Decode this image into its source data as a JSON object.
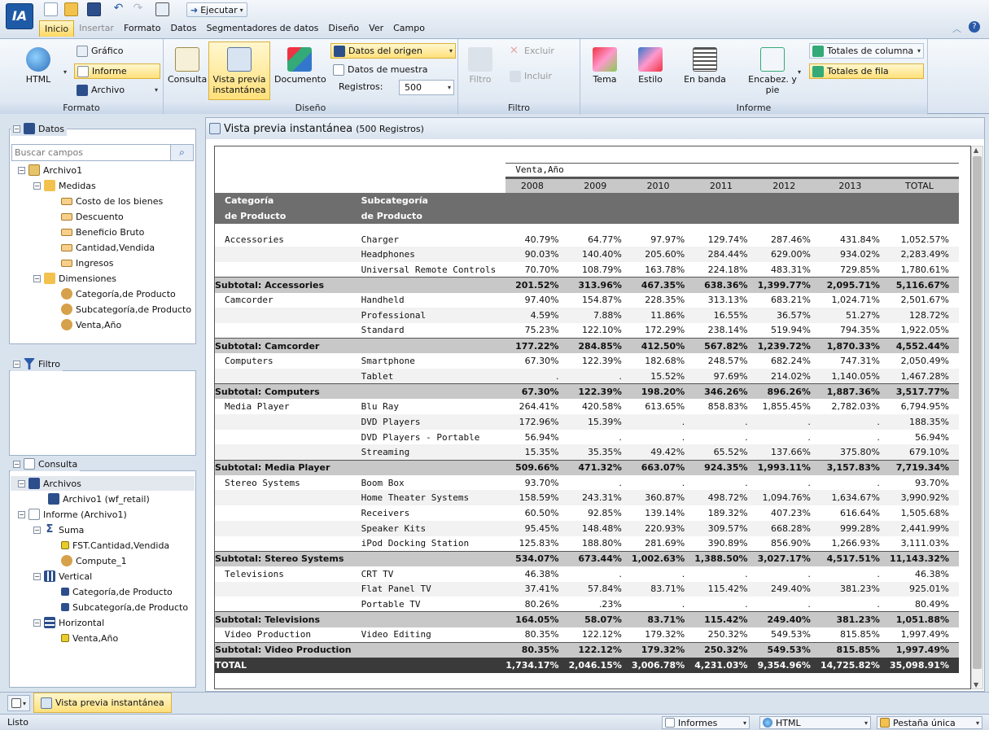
{
  "app": {
    "logo": "IA",
    "run_label": "Ejecutar"
  },
  "menu": {
    "tabs": [
      {
        "label": "Inicio",
        "active": true
      },
      {
        "label": "Insertar",
        "disabled": true
      },
      {
        "label": "Formato"
      },
      {
        "label": "Datos"
      },
      {
        "label": "Segmentadores de datos"
      },
      {
        "label": "Diseño"
      },
      {
        "label": "Ver"
      },
      {
        "label": "Campo"
      }
    ]
  },
  "ribbon": {
    "formato": {
      "label": "Formato",
      "html": "HTML",
      "grafico": "Gráfico",
      "informe": "Informe",
      "archivo": "Archivo"
    },
    "diseno": {
      "label": "Diseño",
      "consulta": "Consulta",
      "vista_previa_1": "Vista previa",
      "vista_previa_2": "instantánea",
      "documento": "Documento",
      "datos_origen": "Datos del origen",
      "datos_muestra": "Datos de muestra",
      "registros_label": "Registros:",
      "registros_value": "500"
    },
    "filtro": {
      "label": "Filtro",
      "filtro": "Filtro",
      "excluir": "Excluir",
      "incluir": "Incluir"
    },
    "informe": {
      "label": "Informe",
      "tema": "Tema",
      "estilo": "Estilo",
      "en_banda": "En banda",
      "encabez_1": "Encabez. y",
      "encabez_2": "pie",
      "totales_columna": "Totales de columna",
      "totales_fila": "Totales de fila"
    }
  },
  "left": {
    "datos_title": "Datos",
    "search_placeholder": "Buscar campos",
    "tree": {
      "archivo": "Archivo1",
      "medidas": "Medidas",
      "measures": [
        "Costo de los bienes",
        "Descuento",
        "Beneficio Bruto",
        "Cantidad,Vendida",
        "Ingresos"
      ],
      "dimensiones": "Dimensiones",
      "dimensions": [
        "Categoría,de Producto",
        "Subcategoría,de Producto",
        "Venta,Año"
      ]
    },
    "filtro_title": "Filtro",
    "consulta_title": "Consulta",
    "query": {
      "archivos": "Archivos",
      "archivo1": "Archivo1 (wf_retail)",
      "informe": "Informe (Archivo1)",
      "suma": "Suma",
      "suma_items": [
        "FST.Cantidad,Vendida",
        "Compute_1"
      ],
      "vertical": "Vertical",
      "vertical_items": [
        "Categoría,de Producto",
        "Subcategoría,de Producto"
      ],
      "horizontal": "Horizontal",
      "horizontal_items": [
        "Venta,Año"
      ]
    }
  },
  "main": {
    "title": "Vista previa instantánea",
    "subtitle": "(500 Registros)",
    "report": {
      "across_title": "Venta,Año",
      "years": [
        "2008",
        "2009",
        "2010",
        "2011",
        "2012",
        "2013",
        "TOTAL"
      ],
      "col_headers": [
        [
          "Categoría",
          "de Producto"
        ],
        [
          "Subcategoría",
          "de Producto"
        ]
      ],
      "rows": [
        {
          "type": "row",
          "cat": "Accessories",
          "sub": "Charger",
          "v": [
            "40.79%",
            "64.77%",
            "97.97%",
            "129.74%",
            "287.46%",
            "431.84%",
            "1,052.57%"
          ]
        },
        {
          "type": "row",
          "cat": "",
          "sub": "Headphones",
          "v": [
            "90.03%",
            "140.40%",
            "205.60%",
            "284.44%",
            "629.00%",
            "934.02%",
            "2,283.49%"
          ]
        },
        {
          "type": "row",
          "cat": "",
          "sub": "Universal Remote Controls",
          "v": [
            "70.70%",
            "108.79%",
            "163.78%",
            "224.18%",
            "483.31%",
            "729.85%",
            "1,780.61%"
          ]
        },
        {
          "type": "sub",
          "cat": "Subtotal: Accessories",
          "sub": "",
          "v": [
            "201.52%",
            "313.96%",
            "467.35%",
            "638.36%",
            "1,399.77%",
            "2,095.71%",
            "5,116.67%"
          ]
        },
        {
          "type": "row",
          "cat": "Camcorder",
          "sub": "Handheld",
          "v": [
            "97.40%",
            "154.87%",
            "228.35%",
            "313.13%",
            "683.21%",
            "1,024.71%",
            "2,501.67%"
          ]
        },
        {
          "type": "row",
          "cat": "",
          "sub": "Professional",
          "v": [
            "4.59%",
            "7.88%",
            "11.86%",
            "16.55%",
            "36.57%",
            "51.27%",
            "128.72%"
          ]
        },
        {
          "type": "row",
          "cat": "",
          "sub": "Standard",
          "v": [
            "75.23%",
            "122.10%",
            "172.29%",
            "238.14%",
            "519.94%",
            "794.35%",
            "1,922.05%"
          ]
        },
        {
          "type": "sub",
          "cat": "Subtotal: Camcorder",
          "sub": "",
          "v": [
            "177.22%",
            "284.85%",
            "412.50%",
            "567.82%",
            "1,239.72%",
            "1,870.33%",
            "4,552.44%"
          ]
        },
        {
          "type": "row",
          "cat": "Computers",
          "sub": "Smartphone",
          "v": [
            "67.30%",
            "122.39%",
            "182.68%",
            "248.57%",
            "682.24%",
            "747.31%",
            "2,050.49%"
          ]
        },
        {
          "type": "row",
          "cat": "",
          "sub": "Tablet",
          "v": [
            ".",
            ".",
            "15.52%",
            "97.69%",
            "214.02%",
            "1,140.05%",
            "1,467.28%"
          ]
        },
        {
          "type": "sub",
          "cat": "Subtotal: Computers",
          "sub": "",
          "v": [
            "67.30%",
            "122.39%",
            "198.20%",
            "346.26%",
            "896.26%",
            "1,887.36%",
            "3,517.77%"
          ]
        },
        {
          "type": "row",
          "cat": "Media Player",
          "sub": "Blu Ray",
          "v": [
            "264.41%",
            "420.58%",
            "613.65%",
            "858.83%",
            "1,855.45%",
            "2,782.03%",
            "6,794.95%"
          ]
        },
        {
          "type": "row",
          "cat": "",
          "sub": "DVD Players",
          "v": [
            "172.96%",
            "15.39%",
            ".",
            ".",
            ".",
            ".",
            "188.35%"
          ]
        },
        {
          "type": "row",
          "cat": "",
          "sub": "DVD Players - Portable",
          "v": [
            "56.94%",
            ".",
            ".",
            ".",
            ".",
            ".",
            "56.94%"
          ]
        },
        {
          "type": "row",
          "cat": "",
          "sub": "Streaming",
          "v": [
            "15.35%",
            "35.35%",
            "49.42%",
            "65.52%",
            "137.66%",
            "375.80%",
            "679.10%"
          ]
        },
        {
          "type": "sub",
          "cat": "Subtotal: Media Player",
          "sub": "",
          "v": [
            "509.66%",
            "471.32%",
            "663.07%",
            "924.35%",
            "1,993.11%",
            "3,157.83%",
            "7,719.34%"
          ]
        },
        {
          "type": "row",
          "cat": "Stereo Systems",
          "sub": "Boom Box",
          "v": [
            "93.70%",
            ".",
            ".",
            ".",
            ".",
            ".",
            "93.70%"
          ]
        },
        {
          "type": "row",
          "cat": "",
          "sub": "Home Theater Systems",
          "v": [
            "158.59%",
            "243.31%",
            "360.87%",
            "498.72%",
            "1,094.76%",
            "1,634.67%",
            "3,990.92%"
          ]
        },
        {
          "type": "row",
          "cat": "",
          "sub": "Receivers",
          "v": [
            "60.50%",
            "92.85%",
            "139.14%",
            "189.32%",
            "407.23%",
            "616.64%",
            "1,505.68%"
          ]
        },
        {
          "type": "row",
          "cat": "",
          "sub": "Speaker Kits",
          "v": [
            "95.45%",
            "148.48%",
            "220.93%",
            "309.57%",
            "668.28%",
            "999.28%",
            "2,441.99%"
          ]
        },
        {
          "type": "row",
          "cat": "",
          "sub": "iPod Docking Station",
          "v": [
            "125.83%",
            "188.80%",
            "281.69%",
            "390.89%",
            "856.90%",
            "1,266.93%",
            "3,111.03%"
          ]
        },
        {
          "type": "sub",
          "cat": "Subtotal: Stereo Systems",
          "sub": "",
          "v": [
            "534.07%",
            "673.44%",
            "1,002.63%",
            "1,388.50%",
            "3,027.17%",
            "4,517.51%",
            "11,143.32%"
          ]
        },
        {
          "type": "row",
          "cat": "Televisions",
          "sub": "CRT TV",
          "v": [
            "46.38%",
            ".",
            ".",
            ".",
            ".",
            ".",
            "46.38%"
          ]
        },
        {
          "type": "row",
          "cat": "",
          "sub": "Flat Panel TV",
          "v": [
            "37.41%",
            "57.84%",
            "83.71%",
            "115.42%",
            "249.40%",
            "381.23%",
            "925.01%"
          ]
        },
        {
          "type": "row",
          "cat": "",
          "sub": "Portable TV",
          "v": [
            "80.26%",
            ".23%",
            ".",
            ".",
            ".",
            ".",
            "80.49%"
          ]
        },
        {
          "type": "sub",
          "cat": "Subtotal: Televisions",
          "sub": "",
          "v": [
            "164.05%",
            "58.07%",
            "83.71%",
            "115.42%",
            "249.40%",
            "381.23%",
            "1,051.88%"
          ]
        },
        {
          "type": "row",
          "cat": "Video Production",
          "sub": "Video Editing",
          "v": [
            "80.35%",
            "122.12%",
            "179.32%",
            "250.32%",
            "549.53%",
            "815.85%",
            "1,997.49%"
          ]
        },
        {
          "type": "sub",
          "cat": "Subtotal: Video Production",
          "sub": "",
          "v": [
            "80.35%",
            "122.12%",
            "179.32%",
            "250.32%",
            "549.53%",
            "815.85%",
            "1,997.49%"
          ]
        },
        {
          "type": "tot",
          "cat": "TOTAL",
          "sub": "",
          "v": [
            "1,734.17%",
            "2,046.15%",
            "3,006.78%",
            "4,231.03%",
            "9,354.96%",
            "14,725.82%",
            "35,098.91%"
          ]
        }
      ]
    }
  },
  "bottom_tab": "Vista previa instantánea",
  "status": {
    "text": "Listo",
    "informes": "Informes",
    "html": "HTML",
    "pestana": "Pestaña única"
  }
}
